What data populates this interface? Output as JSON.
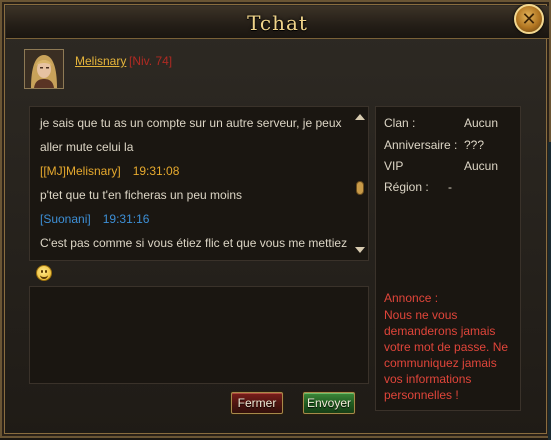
{
  "window": {
    "title": "Tchat"
  },
  "icons": {
    "close": "close-icon",
    "emoji": "smiley-icon",
    "scroll_up": "arrow-up-icon",
    "scroll_down": "arrow-down-icon"
  },
  "profile": {
    "name": "Melisnary",
    "level": "[Niv. 74]"
  },
  "chat": {
    "lines": [
      {
        "type": "text",
        "text": "je sais que tu as un compte sur un autre serveur, je peux"
      },
      {
        "type": "text",
        "text": "aller mute celui la"
      },
      {
        "type": "header",
        "role": "mj",
        "sender": "[[MJ]Melisnary]",
        "time": "19:31:08"
      },
      {
        "type": "text",
        "text": "p'tet que tu t'en ficheras un peu moins"
      },
      {
        "type": "header",
        "role": "other",
        "sender": "[Suonani]",
        "time": "19:31:16"
      },
      {
        "type": "text",
        "text": "C'est pas comme si vous étiez flic et que vous me mettiez"
      }
    ],
    "input_value": ""
  },
  "buttons": {
    "close_label": "Fermer",
    "send_label": "Envoyer"
  },
  "info": {
    "clan_label": "Clan :",
    "clan_value": "Aucun",
    "birthday_label": "Anniversaire :",
    "birthday_value": "???",
    "vip_label": "VIP",
    "vip_value": "Aucun",
    "region_label": "Région :",
    "region_value": "-"
  },
  "announcement": {
    "title": "Annonce :",
    "text": "Nous ne vous demanderons jamais votre mot de passe. Ne communiquez jamais vos informations personnelles !"
  },
  "colors": {
    "accent_gold": "#e6b53b",
    "level_red": "#b02a22",
    "mj_orange": "#e6a92e",
    "player_blue": "#3d8fd6",
    "announce_red": "#e0453a",
    "send_green": "#2f7a2c",
    "close_red": "#6a1a16"
  }
}
